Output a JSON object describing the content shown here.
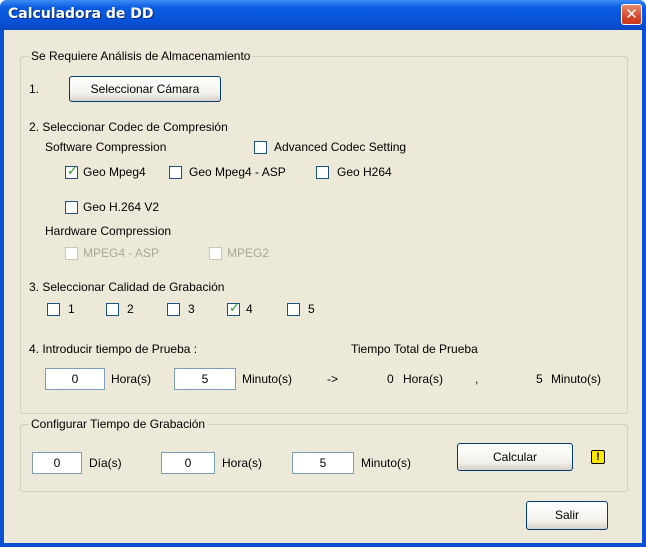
{
  "window": {
    "title": "Calculadora de DD",
    "close_icon": "✕"
  },
  "storage": {
    "legend": "Se Requiere Análisis de Almacenamiento",
    "step1": {
      "num": "1.",
      "button": "Seleccionar Cámara"
    },
    "step2": {
      "label": "2. Seleccionar Codec de Compresión",
      "software_label": "Software Compression",
      "advanced_label": "Advanced Codec Setting",
      "advanced_checked": false,
      "codecs": [
        {
          "label": "Geo Mpeg4",
          "checked": true
        },
        {
          "label": "Geo Mpeg4 - ASP",
          "checked": false
        },
        {
          "label": "Geo H264",
          "checked": false
        },
        {
          "label": "Geo H.264 V2",
          "checked": false
        }
      ],
      "hardware_label": "Hardware Compression",
      "hardware": [
        {
          "label": "MPEG4 - ASP",
          "checked": false,
          "disabled": true
        },
        {
          "label": "MPEG2",
          "checked": false,
          "disabled": true
        }
      ]
    },
    "step3": {
      "label": "3. Seleccionar Calidad de Grabación",
      "qualities": [
        {
          "label": "1",
          "checked": false
        },
        {
          "label": "2",
          "checked": false
        },
        {
          "label": "3",
          "checked": false
        },
        {
          "label": "4",
          "checked": true
        },
        {
          "label": "5",
          "checked": false
        }
      ]
    },
    "step4": {
      "label": "4. Introducir tiempo de Prueba :",
      "total_label": "Tiempo Total de Prueba",
      "hours_value": "0",
      "hours_unit": "Hora(s)",
      "minutes_value": "5",
      "minutes_unit": "Minuto(s)",
      "arrow": "->",
      "total_hours": "0",
      "total_hours_unit": "Hora(s)",
      "comma": ",",
      "total_minutes": "5",
      "total_minutes_unit": "Minuto(s)"
    }
  },
  "recording": {
    "legend": "Configurar Tiempo de Grabación",
    "days_value": "0",
    "days_unit": "Día(s)",
    "hours_value": "0",
    "hours_unit": "Hora(s)",
    "minutes_value": "5",
    "minutes_unit": "Minuto(s)",
    "calc_button": "Calcular",
    "warning_icon": "!"
  },
  "footer": {
    "exit_button": "Salir"
  }
}
